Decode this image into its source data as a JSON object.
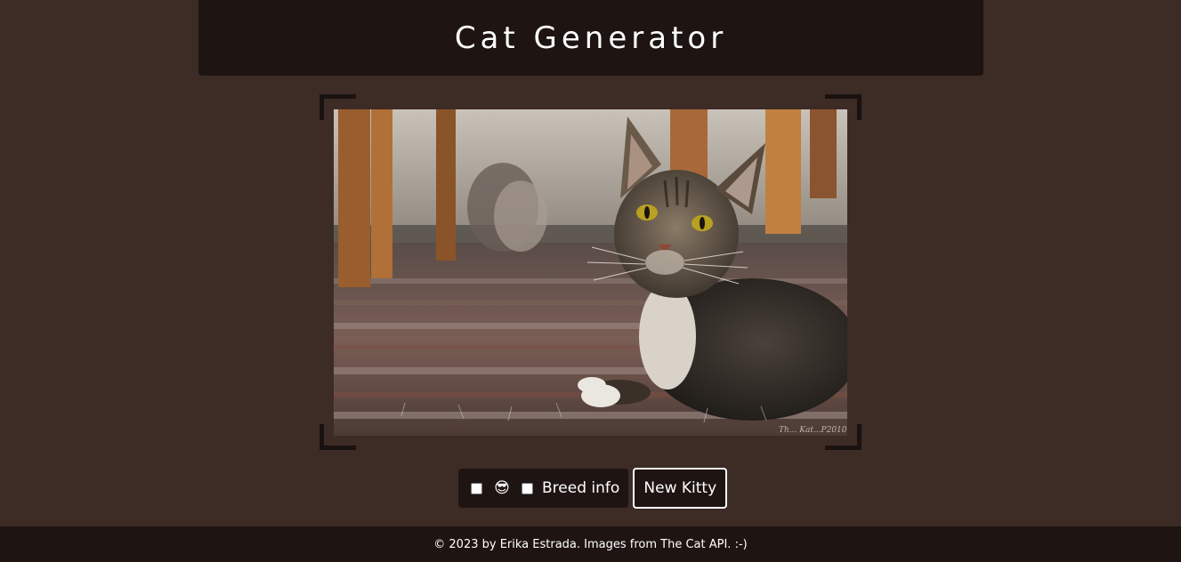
{
  "header": {
    "title": "Cat Generator"
  },
  "photo": {
    "watermark": "Th... Kat...P2010"
  },
  "controls": {
    "emoji_toggle_icon": "😎",
    "breed_info_label": "Breed info",
    "new_kitty_label": "New Kitty"
  },
  "footer": {
    "text": "© 2023 by Erika Estrada. Images from The Cat API. :-)"
  },
  "colors": {
    "background": "#3d2b25",
    "panel": "#1e1513",
    "text": "#ffffff"
  }
}
